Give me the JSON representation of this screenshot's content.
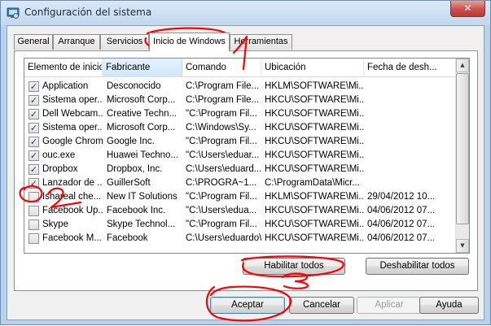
{
  "window": {
    "title": "Configuración del sistema",
    "close_glyph": "✕"
  },
  "tabs": [
    {
      "label": "General",
      "active": false
    },
    {
      "label": "Arranque",
      "active": false
    },
    {
      "label": "Servicios",
      "active": false
    },
    {
      "label": "Inicio de Windows",
      "active": true
    },
    {
      "label": "Herramientas",
      "active": false
    }
  ],
  "list": {
    "columns": [
      "Elemento de inicio",
      "Fabricante",
      "Comando",
      "Ubicación",
      "Fecha de desh..."
    ],
    "sorted_column": "Fabricante",
    "rows": [
      {
        "checked": true,
        "item": "Application",
        "maker": "Desconocido",
        "command": "C:\\Program File...",
        "location": "HKLM\\SOFTWARE\\Mi...",
        "date": ""
      },
      {
        "checked": true,
        "item": "Sistema oper...",
        "maker": "Microsoft Corp...",
        "command": "C:\\Program File...",
        "location": "HKCU\\SOFTWARE\\Mi...",
        "date": ""
      },
      {
        "checked": true,
        "item": "Dell Webcam...",
        "maker": "Creative Techn...",
        "command": "\"C:\\Program Fil...",
        "location": "HKCU\\SOFTWARE\\Mi...",
        "date": ""
      },
      {
        "checked": true,
        "item": "Sistema oper...",
        "maker": "Microsoft Corp...",
        "command": "C:\\Windows\\Sy...",
        "location": "HKCU\\SOFTWARE\\Mi...",
        "date": ""
      },
      {
        "checked": true,
        "item": "Google Chrome",
        "maker": "Google Inc.",
        "command": "\"C:\\Program Fil...",
        "location": "HKCU\\SOFTWARE\\Mi...",
        "date": ""
      },
      {
        "checked": true,
        "item": "ouc.exe",
        "maker": "Huawei Techno...",
        "command": "\"C:\\Users\\eduar...",
        "location": "HKCU\\SOFTWARE\\Mi...",
        "date": ""
      },
      {
        "checked": true,
        "item": "Dropbox",
        "maker": "Dropbox, Inc.",
        "command": "C:\\Users\\eduard...",
        "location": "HKCU\\SOFTWARE\\Mi...",
        "date": ""
      },
      {
        "checked": true,
        "item": "Lanzador de ...",
        "maker": "GuillerSoft",
        "command": "C:\\PROGRA~1...",
        "location": "C:\\ProgramData\\Micr...",
        "date": ""
      },
      {
        "checked": false,
        "item": "Ishareal che...",
        "maker": "New IT Solutions",
        "command": "\"C:\\Program Fil...",
        "location": "HKLM\\SOFTWARE\\Mi...",
        "date": "29/04/2012 10..."
      },
      {
        "checked": false,
        "item": "Facebook Up...",
        "maker": "Facebook Inc.",
        "command": "\"C:\\Users\\edua...",
        "location": "HKCU\\SOFTWARE\\Mi...",
        "date": "04/06/2012 07..."
      },
      {
        "checked": false,
        "item": "Skype",
        "maker": "Skype Technol...",
        "command": "\"C:\\Program Fil...",
        "location": "HKCU\\SOFTWARE\\Mi...",
        "date": "04/06/2012 07..."
      },
      {
        "checked": false,
        "item": "Facebook M...",
        "maker": "Facebook",
        "command": "C:\\Users\\eduardo\\A...",
        "location": "HKCU\\SOFTWARE\\Mi...",
        "date": "04/06/2012 07..."
      }
    ]
  },
  "panel_buttons": {
    "enable_all": "Habilitar todos",
    "disable_all": "Deshabilitar todos"
  },
  "dialog_buttons": {
    "ok": "Aceptar",
    "cancel": "Cancelar",
    "apply": "Aplicar",
    "help": "Ayuda"
  },
  "annotations": {
    "color": "#ff0000",
    "labels": [
      "1",
      "2",
      "3"
    ]
  }
}
